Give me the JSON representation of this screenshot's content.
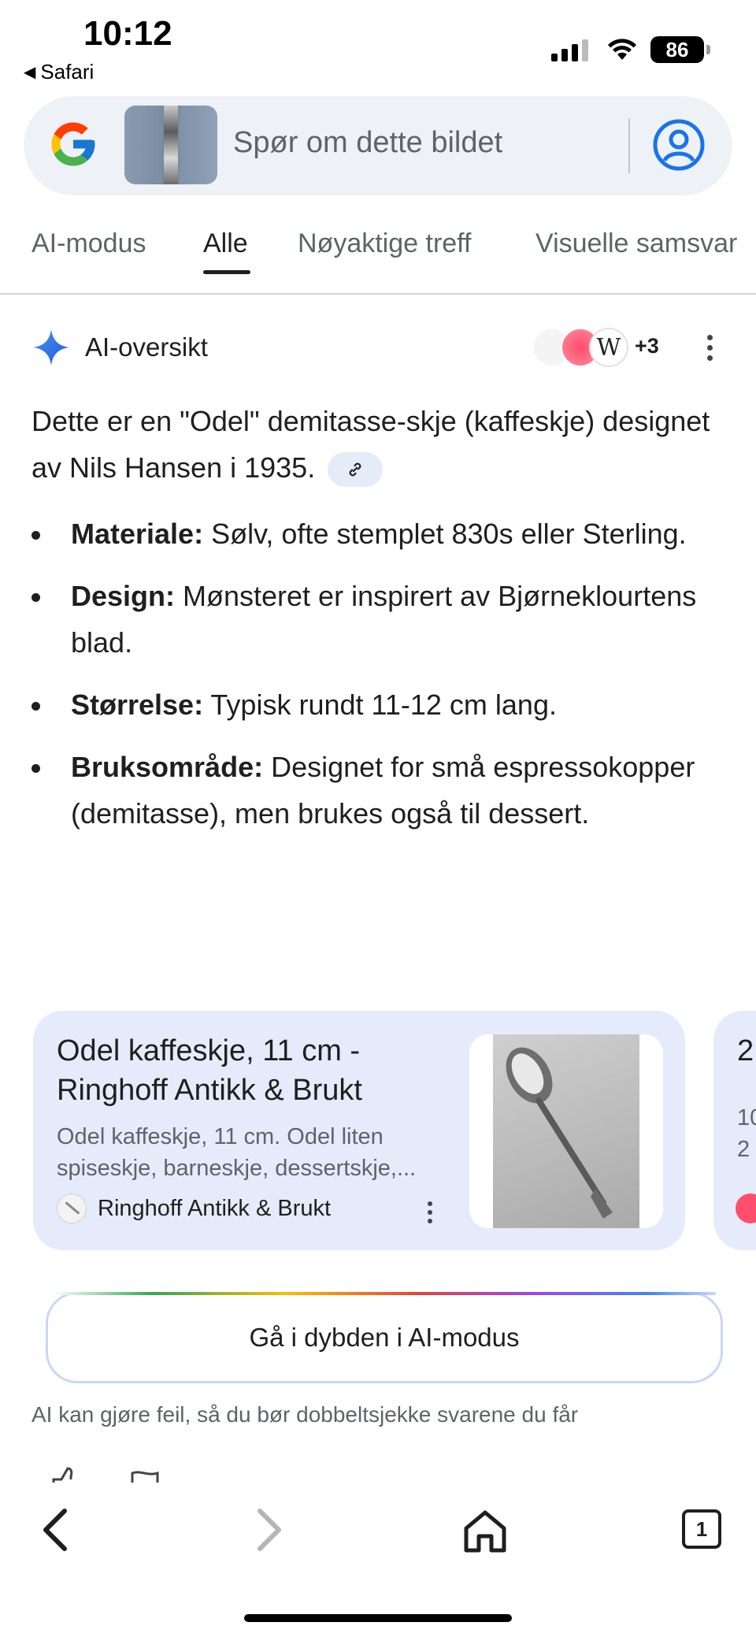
{
  "status_bar": {
    "time": "10:12",
    "back_app": "Safari",
    "battery": "86"
  },
  "search": {
    "placeholder": "Spør om dette bildet"
  },
  "tabs": [
    {
      "label": "AI-modus"
    },
    {
      "label": "Alle"
    },
    {
      "label": "Nøyaktige treff"
    },
    {
      "label": "Visuelle samsvar"
    }
  ],
  "ai_overview": {
    "title": "AI-oversikt",
    "source_count": "+3",
    "intro": "Dette er en \"Odel\" demitasse-skje (kaffeskje) designet av Nils Hansen i 1935.",
    "bullets": [
      {
        "term": "Materiale:",
        "text": " Sølv, ofte stemplet 830s eller Sterling."
      },
      {
        "term": "Design:",
        "text": " Mønsteret er inspirert av Bjørneklourtens blad."
      },
      {
        "term": "Størrelse:",
        "text": " Typisk rundt 11-12 cm lang."
      },
      {
        "term": "Bruksområde:",
        "text": " Designet for små espressokopper (demitasse), men brukes også til dessert."
      }
    ]
  },
  "source_card": {
    "title": "Odel kaffeskje, 11 cm - Ringhoff Antikk & Brukt",
    "snippet": "Odel kaffeskje, 11 cm. Odel liten spiseskje, barneskje, dessertskje,...",
    "source_name": "Ringhoff Antikk & Brukt"
  },
  "peek_card": {
    "title": "2",
    "snippet_line1": "10",
    "snippet_line2": "2"
  },
  "ai_mode_button": "Gå i dybden i AI-modus",
  "disclaimer": "AI kan gjøre feil, så du bør dobbeltsjekke svarene du får",
  "bottom_nav": {
    "tab_count": "1"
  },
  "colors": {
    "accent_blue": "#1a73e8",
    "card_bg": "#e5ebfa",
    "search_bg": "#eef2f6"
  }
}
